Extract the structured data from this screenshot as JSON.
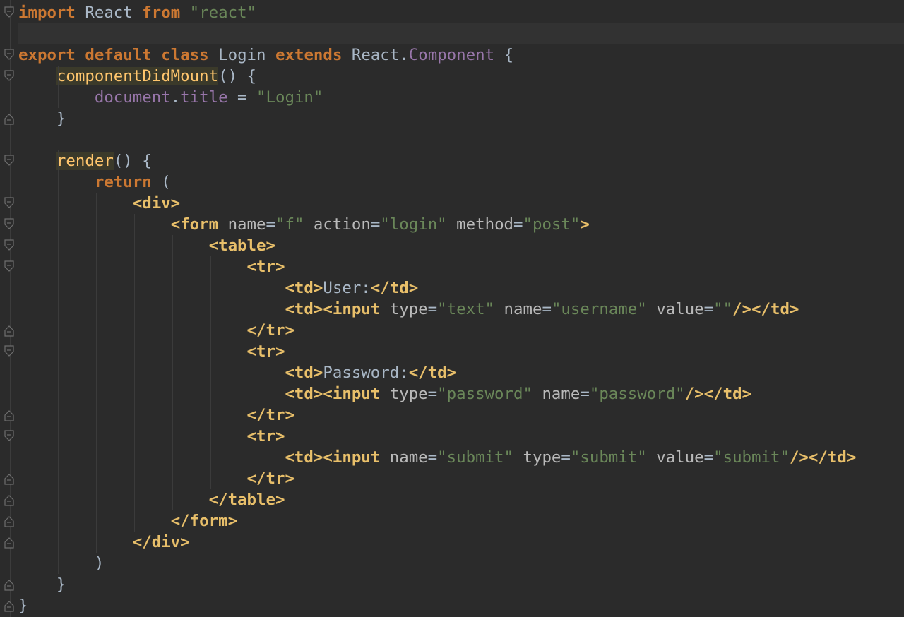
{
  "editor": {
    "language": "javascript-jsx",
    "theme": "dark",
    "colors": {
      "background": "#2b2b2b",
      "keyword": "#cc7832",
      "string": "#6a8759",
      "tag": "#e8bf6a",
      "attribute": "#bababa",
      "property": "#9876aa",
      "text": "#a9b7c6",
      "method_highlight": "#ffc66d"
    },
    "lines": [
      [
        {
          "t": "import",
          "c": "kw"
        },
        {
          "t": " React ",
          "c": "plain"
        },
        {
          "t": "from",
          "c": "kw"
        },
        {
          "t": " ",
          "c": "plain"
        },
        {
          "t": "\"react\"",
          "c": "str"
        }
      ],
      [],
      [
        {
          "t": "export",
          "c": "kw"
        },
        {
          "t": " ",
          "c": "plain"
        },
        {
          "t": "default",
          "c": "kw"
        },
        {
          "t": " ",
          "c": "plain"
        },
        {
          "t": "class",
          "c": "kw"
        },
        {
          "t": " Login ",
          "c": "plain"
        },
        {
          "t": "extends",
          "c": "kw"
        },
        {
          "t": " React.",
          "c": "plain"
        },
        {
          "t": "Component",
          "c": "prop"
        },
        {
          "t": " {",
          "c": "plain"
        }
      ],
      [
        {
          "t": "    ",
          "c": "plain"
        },
        {
          "t": "componentDidMount",
          "c": "hl"
        },
        {
          "t": "() {",
          "c": "plain"
        }
      ],
      [
        {
          "t": "        ",
          "c": "plain"
        },
        {
          "t": "document",
          "c": "prop"
        },
        {
          "t": ".",
          "c": "plain"
        },
        {
          "t": "title",
          "c": "prop"
        },
        {
          "t": " = ",
          "c": "plain"
        },
        {
          "t": "\"Login\"",
          "c": "str"
        }
      ],
      [
        {
          "t": "    }",
          "c": "plain"
        }
      ],
      [],
      [
        {
          "t": "    ",
          "c": "plain"
        },
        {
          "t": "render",
          "c": "hl"
        },
        {
          "t": "() {",
          "c": "plain"
        }
      ],
      [
        {
          "t": "        ",
          "c": "plain"
        },
        {
          "t": "return",
          "c": "kw"
        },
        {
          "t": " (",
          "c": "plain"
        }
      ],
      [
        {
          "t": "            ",
          "c": "plain"
        },
        {
          "t": "<div>",
          "c": "tag"
        }
      ],
      [
        {
          "t": "                ",
          "c": "plain"
        },
        {
          "t": "<form",
          "c": "tag"
        },
        {
          "t": " name",
          "c": "attr"
        },
        {
          "t": "=",
          "c": "plain"
        },
        {
          "t": "\"f\"",
          "c": "str"
        },
        {
          "t": " action",
          "c": "attr"
        },
        {
          "t": "=",
          "c": "plain"
        },
        {
          "t": "\"login\"",
          "c": "str"
        },
        {
          "t": " method",
          "c": "attr"
        },
        {
          "t": "=",
          "c": "plain"
        },
        {
          "t": "\"post\"",
          "c": "str"
        },
        {
          "t": ">",
          "c": "tag"
        }
      ],
      [
        {
          "t": "                    ",
          "c": "plain"
        },
        {
          "t": "<table>",
          "c": "tag"
        }
      ],
      [
        {
          "t": "                        ",
          "c": "plain"
        },
        {
          "t": "<tr>",
          "c": "tag"
        }
      ],
      [
        {
          "t": "                            ",
          "c": "plain"
        },
        {
          "t": "<td>",
          "c": "tag"
        },
        {
          "t": "User:",
          "c": "plain"
        },
        {
          "t": "</td>",
          "c": "tag"
        }
      ],
      [
        {
          "t": "                            ",
          "c": "plain"
        },
        {
          "t": "<td><input",
          "c": "tag"
        },
        {
          "t": " type",
          "c": "attr"
        },
        {
          "t": "=",
          "c": "plain"
        },
        {
          "t": "\"text\"",
          "c": "str"
        },
        {
          "t": " name",
          "c": "attr"
        },
        {
          "t": "=",
          "c": "plain"
        },
        {
          "t": "\"username\"",
          "c": "str"
        },
        {
          "t": " value",
          "c": "attr"
        },
        {
          "t": "=",
          "c": "plain"
        },
        {
          "t": "\"\"",
          "c": "str"
        },
        {
          "t": "/></td>",
          "c": "tag"
        }
      ],
      [
        {
          "t": "                        ",
          "c": "plain"
        },
        {
          "t": "</tr>",
          "c": "tag"
        }
      ],
      [
        {
          "t": "                        ",
          "c": "plain"
        },
        {
          "t": "<tr>",
          "c": "tag"
        }
      ],
      [
        {
          "t": "                            ",
          "c": "plain"
        },
        {
          "t": "<td>",
          "c": "tag"
        },
        {
          "t": "Password:",
          "c": "plain"
        },
        {
          "t": "</td>",
          "c": "tag"
        }
      ],
      [
        {
          "t": "                            ",
          "c": "plain"
        },
        {
          "t": "<td><input",
          "c": "tag"
        },
        {
          "t": " type",
          "c": "attr"
        },
        {
          "t": "=",
          "c": "plain"
        },
        {
          "t": "\"password\"",
          "c": "str"
        },
        {
          "t": " name",
          "c": "attr"
        },
        {
          "t": "=",
          "c": "plain"
        },
        {
          "t": "\"password\"",
          "c": "str"
        },
        {
          "t": "/></td>",
          "c": "tag"
        }
      ],
      [
        {
          "t": "                        ",
          "c": "plain"
        },
        {
          "t": "</tr>",
          "c": "tag"
        }
      ],
      [
        {
          "t": "                        ",
          "c": "plain"
        },
        {
          "t": "<tr>",
          "c": "tag"
        }
      ],
      [
        {
          "t": "                            ",
          "c": "plain"
        },
        {
          "t": "<td><input",
          "c": "tag"
        },
        {
          "t": " name",
          "c": "attr"
        },
        {
          "t": "=",
          "c": "plain"
        },
        {
          "t": "\"submit\"",
          "c": "str"
        },
        {
          "t": " type",
          "c": "attr"
        },
        {
          "t": "=",
          "c": "plain"
        },
        {
          "t": "\"submit\"",
          "c": "str"
        },
        {
          "t": " value",
          "c": "attr"
        },
        {
          "t": "=",
          "c": "plain"
        },
        {
          "t": "\"submit\"",
          "c": "str"
        },
        {
          "t": "/></td>",
          "c": "tag"
        }
      ],
      [
        {
          "t": "                        ",
          "c": "plain"
        },
        {
          "t": "</tr>",
          "c": "tag"
        }
      ],
      [
        {
          "t": "                    ",
          "c": "plain"
        },
        {
          "t": "</table>",
          "c": "tag"
        }
      ],
      [
        {
          "t": "                ",
          "c": "plain"
        },
        {
          "t": "</form>",
          "c": "tag"
        }
      ],
      [
        {
          "t": "            ",
          "c": "plain"
        },
        {
          "t": "</div>",
          "c": "tag"
        }
      ],
      [
        {
          "t": "        )",
          "c": "plain"
        }
      ],
      [
        {
          "t": "    }",
          "c": "plain"
        }
      ],
      [
        {
          "t": "}",
          "c": "plain"
        }
      ]
    ],
    "current_line": 1,
    "fold_markers": [
      {
        "line": 0,
        "kind": "start"
      },
      {
        "line": 2,
        "kind": "start"
      },
      {
        "line": 3,
        "kind": "start"
      },
      {
        "line": 5,
        "kind": "end"
      },
      {
        "line": 7,
        "kind": "start"
      },
      {
        "line": 9,
        "kind": "start"
      },
      {
        "line": 10,
        "kind": "start"
      },
      {
        "line": 11,
        "kind": "start"
      },
      {
        "line": 12,
        "kind": "start"
      },
      {
        "line": 15,
        "kind": "end"
      },
      {
        "line": 16,
        "kind": "start"
      },
      {
        "line": 19,
        "kind": "end"
      },
      {
        "line": 20,
        "kind": "start"
      },
      {
        "line": 22,
        "kind": "end"
      },
      {
        "line": 23,
        "kind": "end"
      },
      {
        "line": 24,
        "kind": "end"
      },
      {
        "line": 25,
        "kind": "end"
      },
      {
        "line": 27,
        "kind": "end"
      },
      {
        "line": 28,
        "kind": "end"
      }
    ]
  }
}
